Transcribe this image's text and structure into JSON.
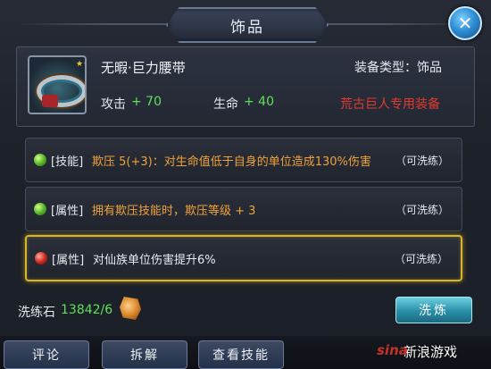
{
  "window": {
    "title": "饰品",
    "close_glyph": "✕"
  },
  "item": {
    "name": "无暇·巨力腰带",
    "stars": "★★★★★",
    "equip_type": "装备类型：饰品",
    "attack_label": "攻击",
    "attack_value": "+ 70",
    "hp_label": "生命",
    "hp_value": "+ 40",
    "exclusive": "荒古巨人专用装备"
  },
  "affixes": [
    {
      "gem": "green",
      "tag": "[技能]",
      "desc": "欺压 5(+3)：对生命值低于自身的单位造成130%伤害",
      "status": "（可洗练）",
      "selected": false
    },
    {
      "gem": "green",
      "tag": "[属性]",
      "desc": "拥有欺压技能时，欺压等级 + 3",
      "status": "（可洗练）",
      "selected": false
    },
    {
      "gem": "red",
      "tag": "[属性]",
      "desc": "对仙族单位伤害提升6%",
      "status": "（可洗练）",
      "selected": true
    }
  ],
  "refine": {
    "stone_label": "洗练石",
    "stone_value": "13842/6",
    "button_label": "洗炼"
  },
  "tabs": {
    "comment": "评论",
    "dismantle": "拆解",
    "view_skills": "查看技能"
  },
  "watermark": {
    "logo": "sina",
    "text": "新浪游戏"
  }
}
